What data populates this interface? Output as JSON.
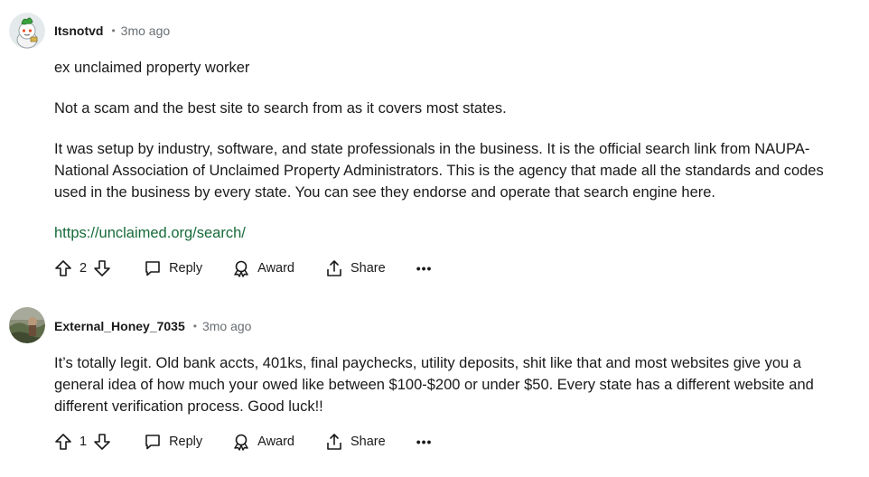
{
  "comments": [
    {
      "author": "Itsnotvd",
      "separator": "•",
      "time": "3mo ago",
      "avatar_icon": "snoo-avatar-icon",
      "paragraphs": [
        "ex unclaimed property worker",
        "Not a scam and the best site to search from as it covers most states.",
        "It was setup by industry, software, and state professionals in the business. It is the official search link from NAUPA- National Association of Unclaimed Property Administrators. This is the agency that made all the standards and codes used in the business by every state. You can see they endorse and operate that search engine here."
      ],
      "link": "https://unclaimed.org/search/",
      "votes": "2",
      "reply_label": "Reply",
      "award_label": "Award",
      "share_label": "Share",
      "more_label": "•••"
    },
    {
      "author": "External_Honey_7035",
      "separator": "•",
      "time": "3mo ago",
      "avatar_icon": "photo-avatar-icon",
      "paragraphs": [
        "It’s totally legit. Old bank accts, 401ks, final paychecks, utility deposits, shit like that and most websites give you a general idea of how much your owed like between $100-$200 or under $50. Every state has a different website and different verification process. Good luck!!"
      ],
      "votes": "1",
      "reply_label": "Reply",
      "award_label": "Award",
      "share_label": "Share",
      "more_label": "•••"
    }
  ],
  "colors": {
    "text": "#1a1a1b",
    "meta": "#6a6f73",
    "link": "#176b3a"
  }
}
